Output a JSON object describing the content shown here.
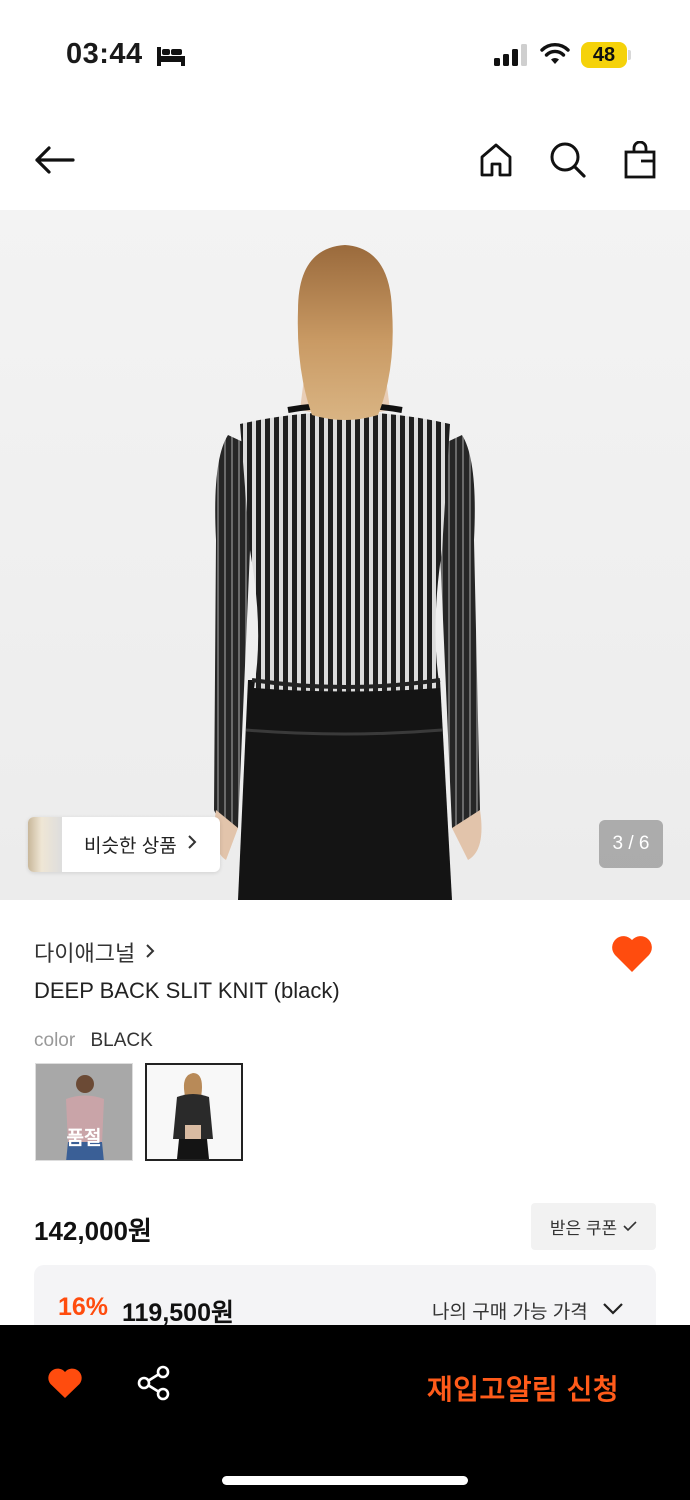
{
  "status_bar": {
    "time": "03:44",
    "battery": "48",
    "icons": [
      "sleep-bed-icon",
      "cellular-signal-icon",
      "wifi-icon",
      "battery-icon"
    ]
  },
  "nav": {
    "icons": [
      "back-arrow-icon",
      "home-icon",
      "search-icon",
      "shopping-bag-icon"
    ]
  },
  "gallery": {
    "similar_label": "비슷한 상품",
    "pager": "3 / 6"
  },
  "product": {
    "brand": "다이애그널",
    "name": "DEEP BACK SLIT KNIT (black)",
    "color_key": "color",
    "color_value": "BLACK",
    "options": [
      {
        "badge": "품절",
        "selected": false
      },
      {
        "badge": "",
        "selected": true
      }
    ],
    "price": "142,000원",
    "coupon_label": "받은 쿠폰",
    "discount": "16%",
    "sale_price": "119,500원",
    "my_price_label": "나의 구매 가능 가격"
  },
  "bottom_bar": {
    "restock_label": "재입고알림 신청",
    "icons": [
      "heart-icon",
      "share-icon"
    ]
  },
  "colors": {
    "accent": "#FF4C0E",
    "bottom_bar_bg": "#000000",
    "battery": "#F5D20A"
  }
}
